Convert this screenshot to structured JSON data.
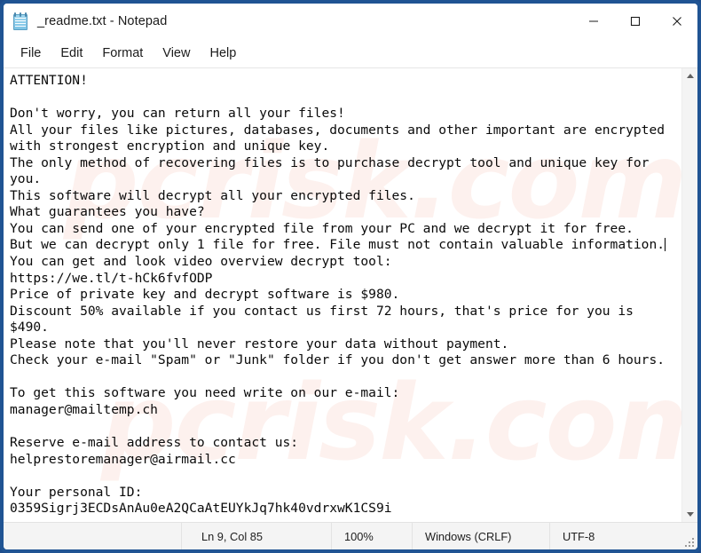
{
  "window": {
    "title": "_readme.txt - Notepad",
    "icon": "notepad-icon",
    "controls": {
      "minimize": "minimize-icon",
      "maximize": "maximize-icon",
      "close": "close-icon"
    },
    "accent_color": "#205493"
  },
  "menubar": {
    "items": [
      {
        "label": "File"
      },
      {
        "label": "Edit"
      },
      {
        "label": "Format"
      },
      {
        "label": "View"
      },
      {
        "label": "Help"
      }
    ]
  },
  "document": {
    "lines": [
      "ATTENTION!",
      "",
      "Don't worry, you can return all your files!",
      "All your files like pictures, databases, documents and other important are encrypted",
      "with strongest encryption and unique key.",
      "The only method of recovering files is to purchase decrypt tool and unique key for",
      "you.",
      "This software will decrypt all your encrypted files.",
      "What guarantees you have?",
      "You can send one of your encrypted file from your PC and we decrypt it for free.",
      "But we can decrypt only 1 file for free. File must not contain valuable information.",
      "You can get and look video overview decrypt tool:",
      "https://we.tl/t-hCk6fvfODP",
      "Price of private key and decrypt software is $980.",
      "Discount 50% available if you contact us first 72 hours, that's price for you is",
      "$490.",
      "Please note that you'll never restore your data without payment.",
      "Check your e-mail \"Spam\" or \"Junk\" folder if you don't get answer more than 6 hours.",
      "",
      "To get this software you need write on our e-mail:",
      "manager@mailtemp.ch",
      "",
      "Reserve e-mail address to contact us:",
      "helprestoremanager@airmail.cc",
      "",
      "Your personal ID:",
      "0359Sigrj3ECDsAnAu0eA2QCaAtEUYkJq7hk40vdrxwK1CS9i"
    ],
    "caret_after_line_index": 10,
    "watermark_text": "pcrisk.com"
  },
  "statusbar": {
    "line_column": "Ln 9, Col 85",
    "zoom": "100%",
    "line_endings": "Windows (CRLF)",
    "encoding": "UTF-8"
  },
  "scrollbar": {
    "up_arrow": "scroll-up-icon",
    "down_arrow": "scroll-down-icon"
  }
}
